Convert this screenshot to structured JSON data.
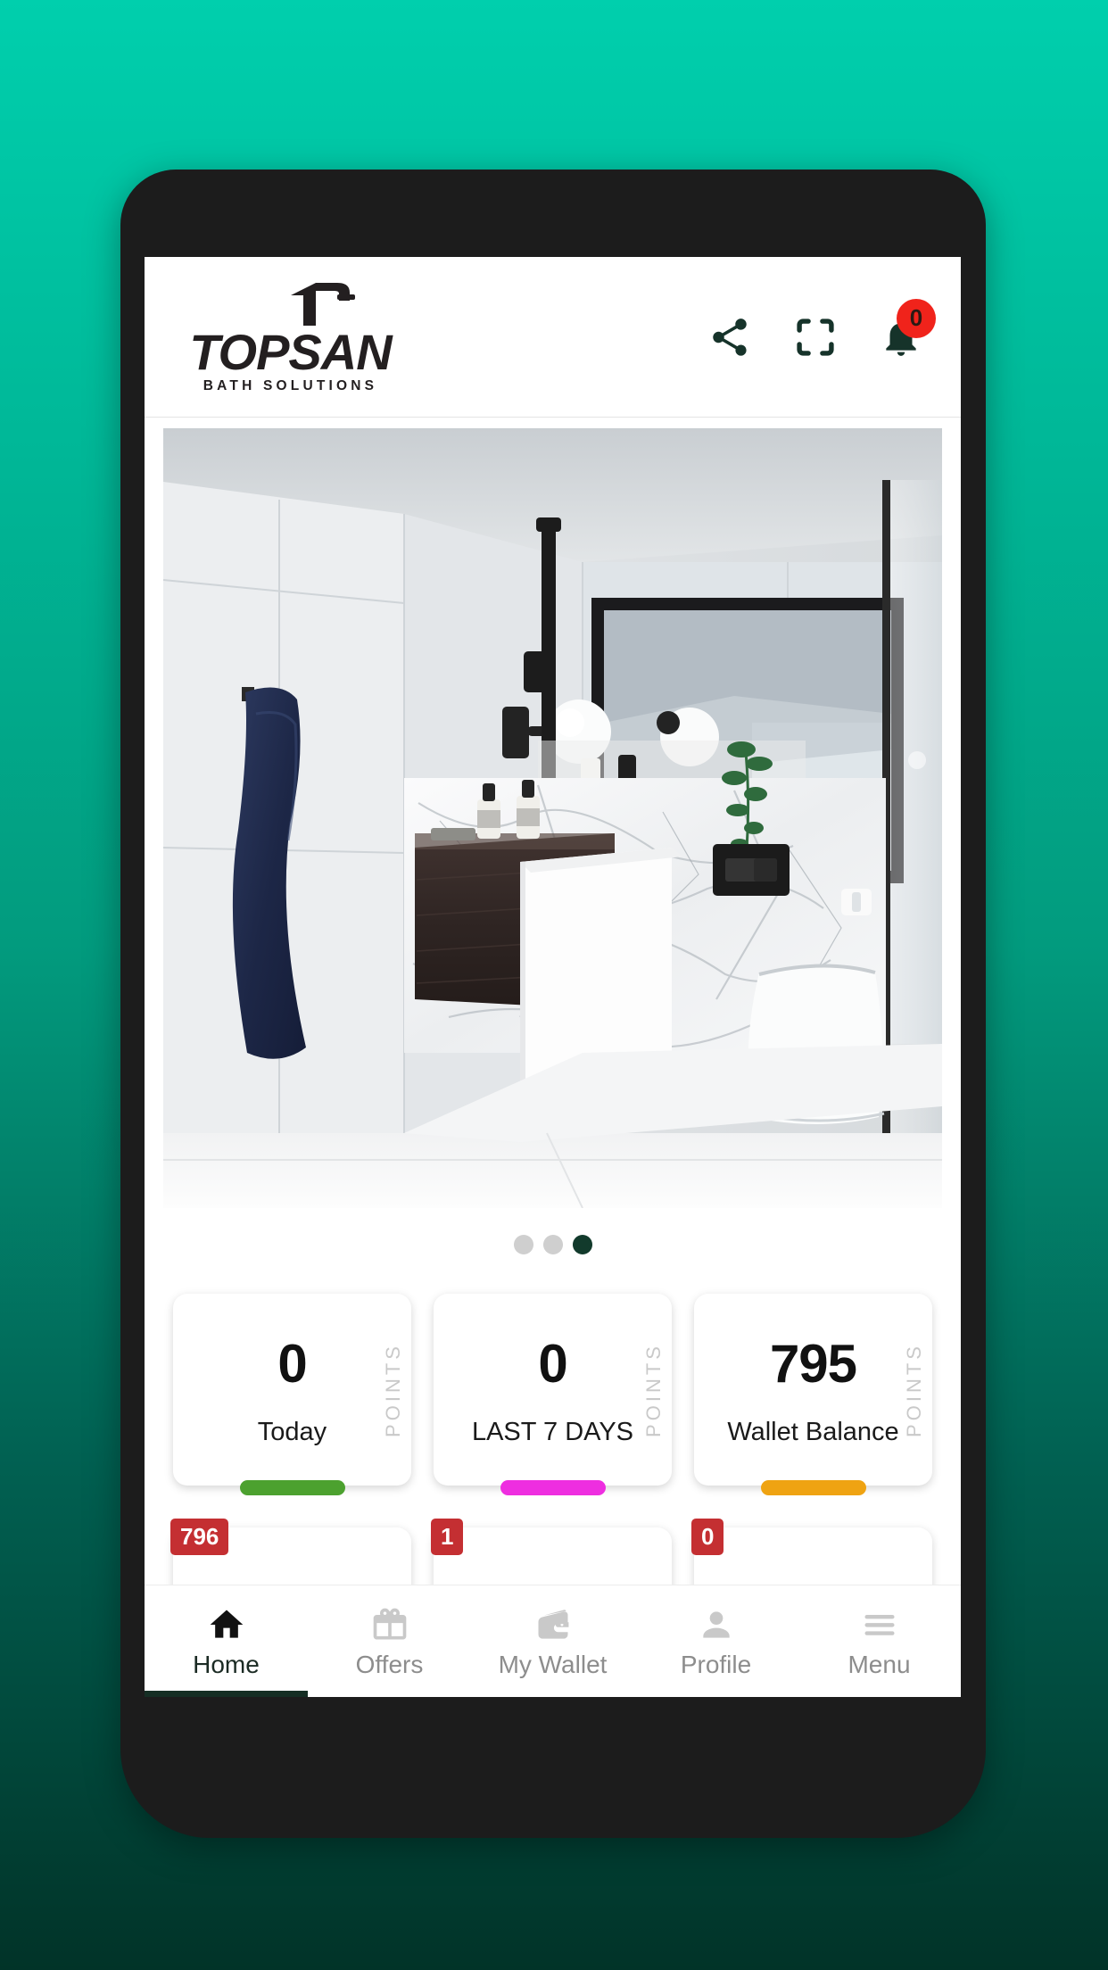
{
  "background": {
    "gradient_top": "#00CFAD",
    "gradient_bottom": "#013328"
  },
  "device": {
    "frame_color": "#1c1c1c"
  },
  "header": {
    "brand_name": "TOPSAN",
    "brand_tagline": "BATH SOLUTIONS",
    "logo_icon": "faucet-icon",
    "actions": [
      {
        "name": "share-icon",
        "label": "Share"
      },
      {
        "name": "qr-scan-icon",
        "label": "Scan"
      },
      {
        "name": "notification-bell-icon",
        "label": "Notifications",
        "badge": "0",
        "badge_color": "#F0231B"
      }
    ]
  },
  "carousel": {
    "image_alt": "Modern bathroom with marble wall, dark wood vanity, white pedestal sink, navy towel and wall-hung toilet",
    "dots": [
      {
        "active": false
      },
      {
        "active": false
      },
      {
        "active": true
      }
    ],
    "active_dot_color": "#123a2c",
    "inactive_dot_color": "#cfcfcf"
  },
  "stats": {
    "points_label": "POINTS",
    "cards": [
      {
        "value": "0",
        "label": "Today",
        "bar_color": "#4CA12F"
      },
      {
        "value": "0",
        "label": "LAST 7 DAYS",
        "bar_color": "#EE2EE0"
      },
      {
        "value": "795",
        "label": "Wallet Balance",
        "bar_color": "#EFA312"
      }
    ]
  },
  "secondary_cards": [
    {
      "badge": "796",
      "badge_color": "#C42F32"
    },
    {
      "badge": "1",
      "badge_color": "#C42F32"
    },
    {
      "badge": "0",
      "badge_color": "#C42F32"
    }
  ],
  "bottom_nav": {
    "items": [
      {
        "label": "Home",
        "icon": "home-icon",
        "active": true
      },
      {
        "label": "Offers",
        "icon": "gift-icon",
        "active": false
      },
      {
        "label": "My Wallet",
        "icon": "wallet-icon",
        "active": false
      },
      {
        "label": "Profile",
        "icon": "person-icon",
        "active": false
      },
      {
        "label": "Menu",
        "icon": "hamburger-menu-icon",
        "active": false
      }
    ],
    "active_color": "#1b2b24",
    "inactive_color": "#8d8d8d"
  }
}
